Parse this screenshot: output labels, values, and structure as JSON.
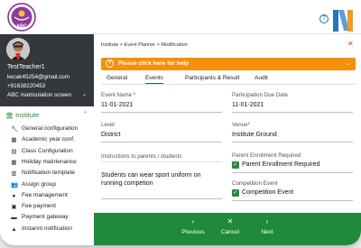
{
  "header": {
    "logo_icon": "abc-school-logo-icon",
    "logo_text": "ABC",
    "help_icon": "help-circle-icon",
    "brand_icon": "n-brand-logo-icon"
  },
  "profile": {
    "name": "TestTeacher1",
    "email": "kecak45254@gmail.com",
    "phone": "+91638220453",
    "school": "ABC matriculation screen",
    "avatar_icon": "profile-photo"
  },
  "sidebar": {
    "section_label": "Institute",
    "section_icon": "building-icon",
    "items": [
      {
        "label": "General configuration",
        "icon": "wrench-icon",
        "glyph": "🔧"
      },
      {
        "label": "Academic year conf.",
        "icon": "calendar-icon",
        "glyph": "▦"
      },
      {
        "label": "Class Configuration",
        "icon": "document-icon",
        "glyph": "▤"
      },
      {
        "label": "Holiday maintenance",
        "icon": "calendar-grid-icon",
        "glyph": "▦"
      },
      {
        "label": "Notification template",
        "icon": "template-icon",
        "glyph": "▥"
      },
      {
        "label": "Assign group",
        "icon": "group-icon",
        "glyph": "👥"
      },
      {
        "label": "Fee management",
        "icon": "coin-icon",
        "glyph": "●"
      },
      {
        "label": "Fee payment",
        "icon": "receipt-icon",
        "glyph": "▣"
      },
      {
        "label": "Payment gateway",
        "icon": "card-icon",
        "glyph": "▬"
      },
      {
        "label": "Instannt notification",
        "icon": "bell-icon",
        "glyph": "▲"
      }
    ]
  },
  "main": {
    "breadcrumb": "Institute > Event Planner > Modification",
    "help_banner": "Please click here for help",
    "tabs": [
      "General",
      "Events",
      "Participants & Result",
      "Audit"
    ],
    "active_tab": "Events",
    "fields": {
      "event_name_label": "Event Name *",
      "event_name_value": "11-01-2021",
      "due_date_label": "Participation Due Date",
      "due_date_value": "11-01-2021",
      "level_label": "Level",
      "level_value": "District",
      "venue_label": "Venue*",
      "venue_value": "Institute Ground",
      "instructions_label": "Instructions to parents / students",
      "instructions_value": "Students can wear sport uniform on running competion",
      "parent_enroll_label": "Parent Enrollment Required",
      "parent_enroll_checkbox": "Parent Enrollment Required",
      "parent_enroll_checked": true,
      "competition_label": "Competition Event",
      "competition_checkbox": "Competition Event",
      "competition_checked": true
    }
  },
  "footer": {
    "previous_label": "Previous",
    "cancel_label": "Cancel",
    "next_label": "Next"
  },
  "colors": {
    "accent_green": "#1f8a3b",
    "banner_orange": "#f58f0c",
    "profile_dark": "#34383d",
    "close_red": "#d23b2c"
  }
}
